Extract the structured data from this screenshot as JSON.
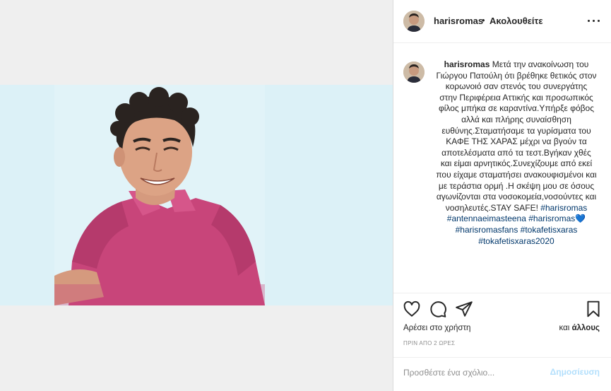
{
  "post": {
    "image_alt": "",
    "author": "harisromas",
    "follow_status": "Ακολουθείτε",
    "separator": "•",
    "caption_text": "Μετά την ανακοίνωση του Γιώργου Πατούλη ότι βρέθηκε θετικός στον κορωνοιό σαν στενός του συνεργάτης στην Περιφέρεια Αττικής και προσωπικός φίλος μπήκα σε καραντίνα.Υπήρξε φόβος αλλά και πλήρης συναίσθηση ευθύνης.Σταματήσαμε τα γυρίσματα του ΚΑΦΕ ΤΗΣ ΧΑΡΑΣ μέχρι να βγούν τα αποτελέσματα από τα τεστ.Βγήκαν χθές και είμαι αρνητικός.Συνεχίζουμε από εκεί που είχαμε σταματήσει ανακουφισμένοι και με τεράστια ορμή .Η σκέψη μου σε όσους αγωνίζονται στα νοσοκομεία,νοσούντες και νοσηλευτές.STAY SAFE!",
    "hashtags": "#harisromas #antennaeimasteena #harisromas💙 #harisromasfans #tokafetisxaras #tokafetisxaras2020",
    "likes_prefix": "Αρέσει στο χρήστη",
    "likes_suffix_and": "και",
    "likes_suffix_others": "άλλους",
    "timestamp": "ΠΡΙΝ ΑΠΟ 2 ΩΡΕΣ",
    "comment_placeholder": "Προσθέστε ένα σχόλιο...",
    "post_button": "Δημοσίευση"
  },
  "icons": {
    "like": "heart-icon",
    "comment": "comment-icon",
    "share": "paper-plane-icon",
    "save": "bookmark-icon",
    "more": "more-options-icon"
  },
  "colors": {
    "link": "#00376b",
    "post_button_disabled": "#b2dffc",
    "muted": "#8e8e8e",
    "photo_background": "#dcf1f7",
    "shirt": "#c8457a"
  }
}
